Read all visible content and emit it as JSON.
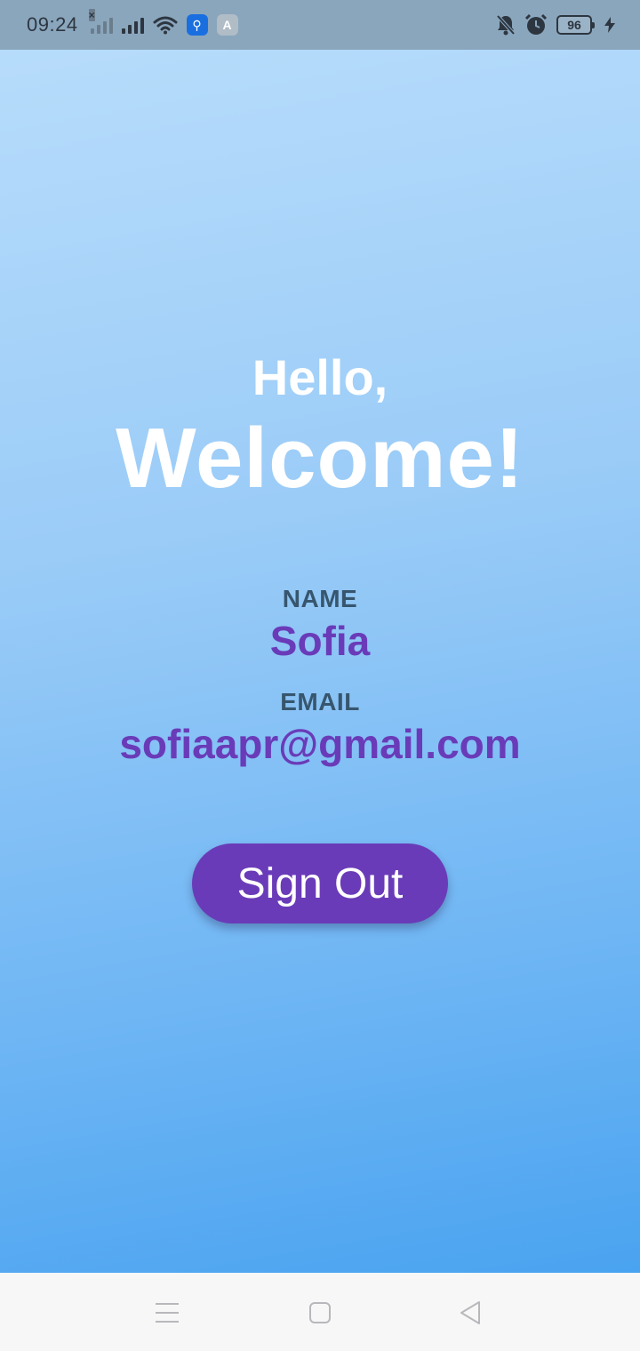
{
  "status_bar": {
    "time": "09:24",
    "battery_level": "96",
    "icons": [
      "signal-no-service-icon",
      "signal-icon",
      "wifi-icon",
      "usb-app-icon",
      "app-store-icon",
      "bell-muted-icon",
      "alarm-icon",
      "battery-icon",
      "charging-icon"
    ]
  },
  "greeting": {
    "hello": "Hello,",
    "welcome": "Welcome!"
  },
  "profile": {
    "name_label": "NAME",
    "name_value": "Sofia",
    "email_label": "EMAIL",
    "email_value": "sofiaapr@gmail.com"
  },
  "actions": {
    "sign_out_label": "Sign Out"
  },
  "nav_bar": {
    "icons": [
      "menu-icon",
      "home-icon",
      "back-icon"
    ]
  },
  "colors": {
    "accent": "#6a3bb8",
    "label": "#37566e",
    "gradient_top": "#b7dcfb",
    "gradient_bottom": "#4aa3f0",
    "status_bar": "#8aa6bd"
  }
}
